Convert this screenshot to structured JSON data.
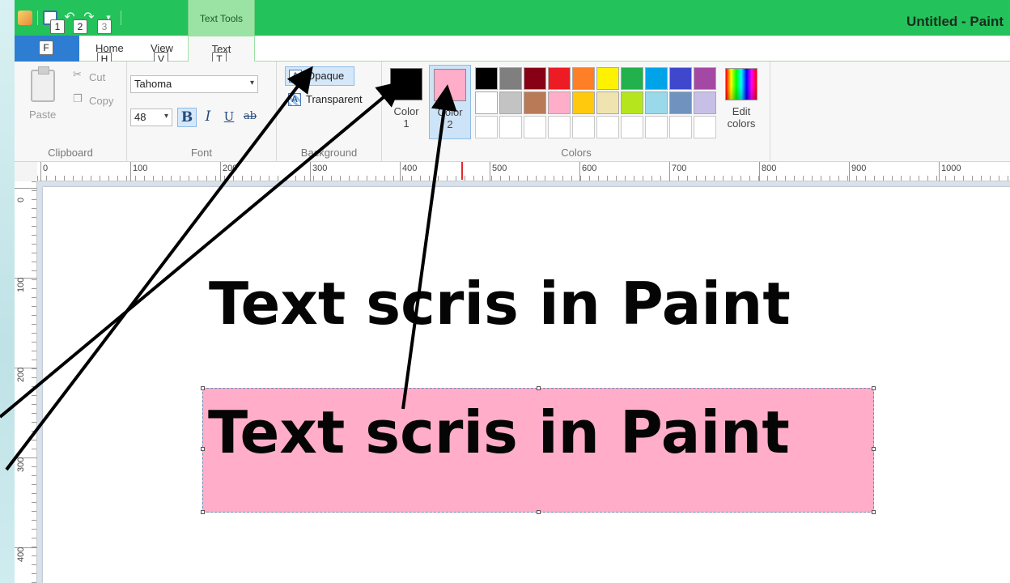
{
  "window": {
    "title": "Untitled - Paint",
    "context_group": "Text Tools"
  },
  "keytips": {
    "qat_1": "1",
    "qat_2": "2",
    "qat_3": "3",
    "file": "F",
    "home": "H",
    "view": "V",
    "text": "T"
  },
  "tabs": {
    "home": "Home",
    "view": "View",
    "text": "Text"
  },
  "clipboard": {
    "paste": "Paste",
    "cut": "Cut",
    "copy": "Copy",
    "group": "Clipboard"
  },
  "font": {
    "family": "Tahoma",
    "size": "48",
    "bold": "B",
    "italic": "I",
    "underline": "U",
    "strike": "ab",
    "group": "Font"
  },
  "background": {
    "opaque": "Opaque",
    "transparent": "Transparent",
    "group": "Background"
  },
  "colors": {
    "group": "Colors",
    "color1_label": "Color",
    "color1_num": "1",
    "color2_label": "Color",
    "color2_num": "2",
    "color1_value": "#000000",
    "color2_value": "#ffadc9",
    "edit_label": "Edit",
    "edit_label2": "colors",
    "palette": [
      "#000000",
      "#7f7f7f",
      "#880015",
      "#ed1c24",
      "#ff7f27",
      "#fff200",
      "#22b14c",
      "#00a2e8",
      "#3f48cc",
      "#a349a4",
      "#ffffff",
      "#c3c3c3",
      "#b97a57",
      "#ffaec9",
      "#ffc90e",
      "#efe4b0",
      "#b5e61d",
      "#99d9ea",
      "#7092be",
      "#c8bfe7",
      "#ffffff",
      "#ffffff",
      "#ffffff",
      "#ffffff",
      "#ffffff",
      "#ffffff",
      "#ffffff",
      "#ffffff",
      "#ffffff",
      "#ffffff"
    ]
  },
  "ruler": {
    "h_labels": [
      "0",
      "100",
      "200",
      "300",
      "400",
      "500",
      "600",
      "700",
      "800",
      "900",
      "1000"
    ],
    "v_labels": [
      "0",
      "100",
      "200",
      "300",
      "400"
    ]
  },
  "canvas": {
    "line1": "Text scris in Paint",
    "line2": "Text scris in Paint"
  }
}
